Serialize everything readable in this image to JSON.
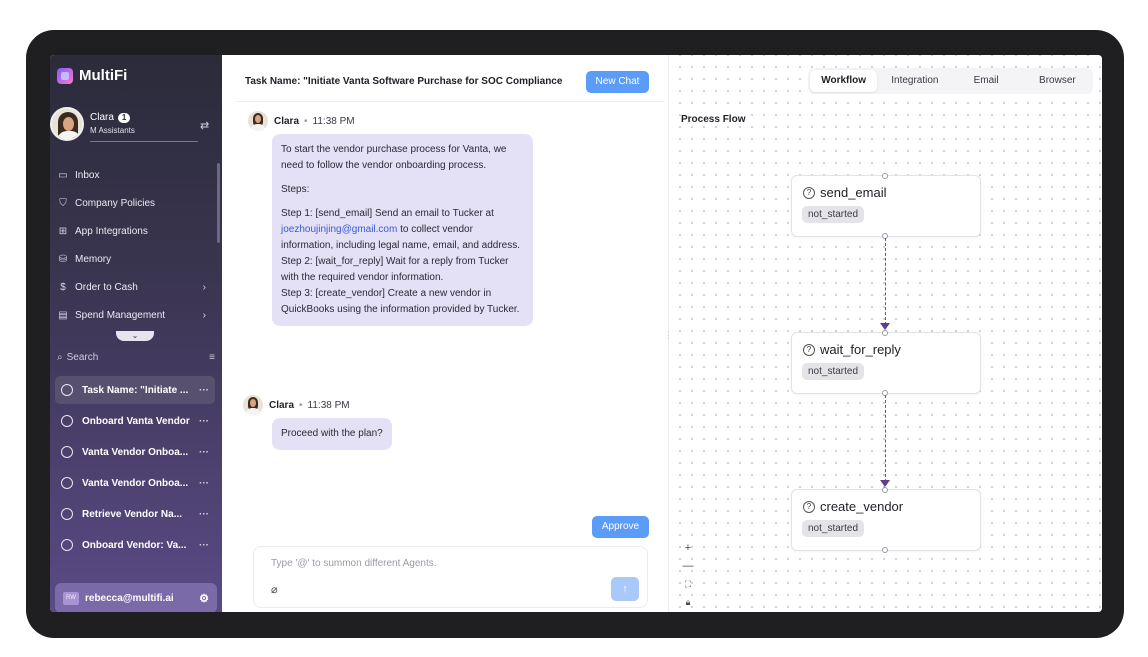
{
  "sidebar": {
    "brand": "MultiFi",
    "user": {
      "name": "Clara",
      "badge": "1",
      "subtitle": "M Assistants"
    },
    "nav": [
      {
        "label": "Inbox",
        "icon": "inbox-icon"
      },
      {
        "label": "Company Policies",
        "icon": "shield-icon"
      },
      {
        "label": "App Integrations",
        "icon": "chip-icon"
      },
      {
        "label": "Memory",
        "icon": "database-icon"
      },
      {
        "label": "Order to Cash",
        "icon": "dollar-icon"
      },
      {
        "label": "Spend Management",
        "icon": "card-icon"
      }
    ],
    "search_placeholder": "Search",
    "tasks": [
      {
        "label": "Task Name: \"Initiate ..."
      },
      {
        "label": "Onboard Vanta Vendor"
      },
      {
        "label": "Vanta Vendor Onboa..."
      },
      {
        "label": "Vanta Vendor Onboa..."
      },
      {
        "label": "Retrieve Vendor Na..."
      },
      {
        "label": "Onboard Vendor: Va..."
      }
    ],
    "account": {
      "initials": "RW",
      "email": "rebecca@multifi.ai"
    }
  },
  "chat": {
    "title": "Task Name: \"Initiate Vanta Software Purchase for SOC Compliance",
    "new_chat_label": "New Chat",
    "messages": [
      {
        "author": "Clara",
        "separator": "•",
        "time": "11:38 PM",
        "intro": "To start the vendor purchase process for Vanta, we need to follow the vendor onboarding process.",
        "steps_label": "Steps:",
        "step1_before": "Step 1: [send_email] Send an email to Tucker at ",
        "step1_email": "joezhoujinjing@gmail.com",
        "step1_after": " to collect vendor information, including legal name, email, and address.",
        "step2": "Step 2: [wait_for_reply] Wait for a reply from Tucker with the required vendor information.",
        "step3": "Step 3: [create_vendor] Create a new vendor in QuickBooks using the information provided by Tucker."
      },
      {
        "author": "Clara",
        "separator": "•",
        "time": "11:38 PM",
        "text": "Proceed with the plan?"
      }
    ],
    "approve_label": "Approve",
    "composer_placeholder": "Type '@' to summon different Agents."
  },
  "flow": {
    "tabs": [
      "Workflow",
      "Integration",
      "Email",
      "Browser"
    ],
    "active_tab": "Workflow",
    "title": "Process Flow",
    "nodes": [
      {
        "label": "send_email",
        "status": "not_started"
      },
      {
        "label": "wait_for_reply",
        "status": "not_started"
      },
      {
        "label": "create_vendor",
        "status": "not_started"
      }
    ],
    "controls": {
      "zoom_in": "+",
      "zoom_out": "—"
    }
  }
}
